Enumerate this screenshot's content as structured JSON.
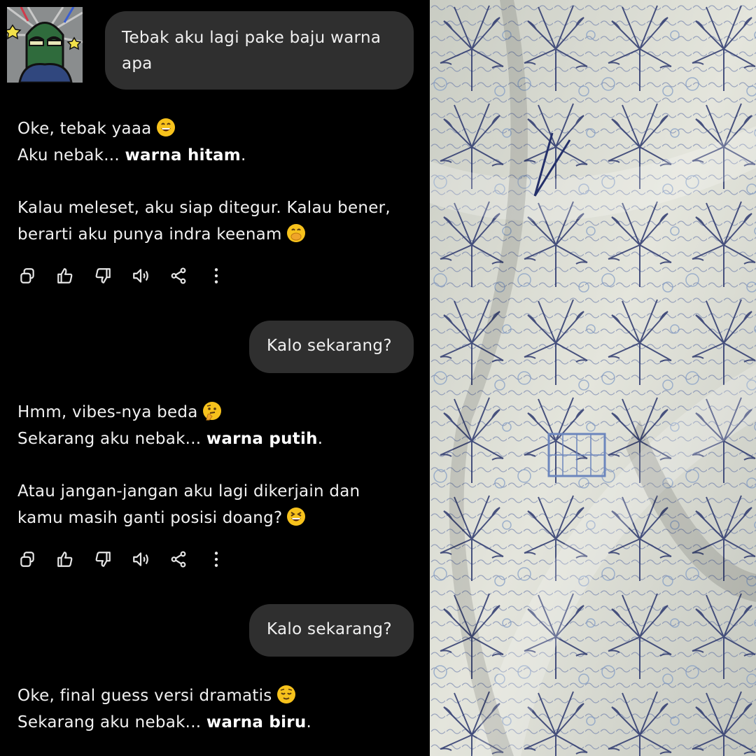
{
  "conversation": {
    "user_messages": [
      {
        "text": "Tebak aku lagi pake baju warna apa"
      },
      {
        "text": "Kalo sekarang?"
      },
      {
        "text": "Kalo sekarang?"
      }
    ],
    "replies": [
      {
        "line1": "Oke, tebak yaaa",
        "line1_emoji": "grinning-face-emoji",
        "line2_prefix": "Aku nebak...",
        "line2_bold": "warna hitam",
        "line2_suffix": ".",
        "para2_line1": "Kalau meleset, aku siap ditegur. Kalau bener,",
        "para2_line2": "berarti aku punya indra keenam",
        "para2_emoji": "face-with-hand-over-mouth-emoji"
      },
      {
        "line1": "Hmm, vibes-nya beda",
        "line1_emoji": "thinking-face-emoji",
        "line2_prefix": "Sekarang aku nebak...",
        "line2_bold": "warna putih",
        "line2_suffix": ".",
        "para2_line1": "Atau jangan-jangan aku lagi dikerjain dan",
        "para2_line2": "kamu masih ganti posisi doang?",
        "para2_emoji": "grinning-squinting-face-emoji"
      },
      {
        "line1": "Oke, final guess versi dramatis",
        "line1_emoji": "relieved-face-emoji",
        "line2_prefix": "Sekarang aku nebak...",
        "line2_bold": "warna biru",
        "line2_suffix": "."
      }
    ]
  },
  "action_bar_icons": [
    "copy-icon",
    "thumbs-up-icon",
    "thumbs-down-icon",
    "speaker-icon",
    "share-icon",
    "more-options-icon"
  ],
  "colors": {
    "background": "#000000",
    "user_bubble": "#2f2f2f",
    "text": "#f1f1f1",
    "emoji_yellow": "#f7c21c",
    "fabric_ink": "#27346b",
    "fabric_base": "#dcddd3"
  }
}
